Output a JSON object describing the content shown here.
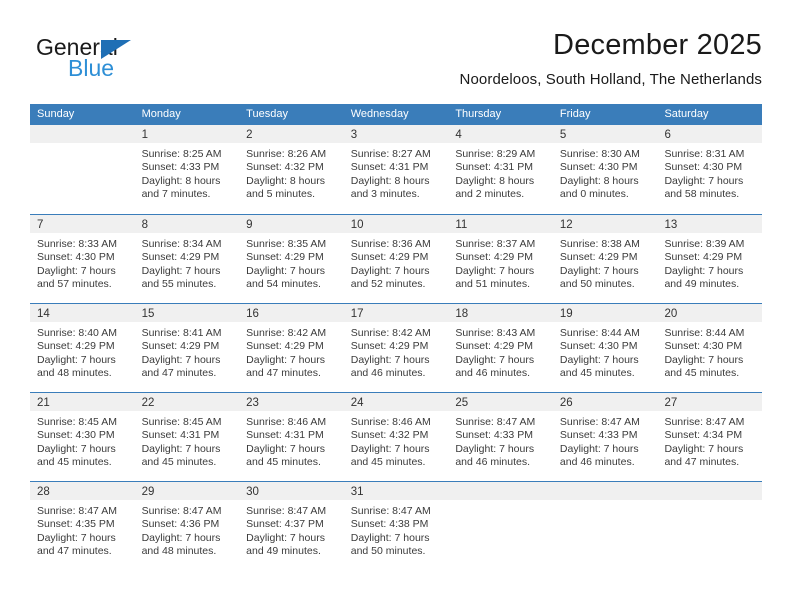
{
  "brand": {
    "name_dark": "General",
    "name_blue": "Blue",
    "accent_color": "#1f6fb5",
    "accent_light": "#2e8fd6"
  },
  "header": {
    "title": "December 2025",
    "location": "Noordeloos, South Holland, The Netherlands"
  },
  "calendar": {
    "header_color": "#3a7dba",
    "day_band_color": "#f0f0f0",
    "weekdays": [
      "Sunday",
      "Monday",
      "Tuesday",
      "Wednesday",
      "Thursday",
      "Friday",
      "Saturday"
    ],
    "weeks": [
      [
        {
          "day": "",
          "lines": []
        },
        {
          "day": "1",
          "lines": [
            "Sunrise: 8:25 AM",
            "Sunset: 4:33 PM",
            "Daylight: 8 hours",
            "and 7 minutes."
          ]
        },
        {
          "day": "2",
          "lines": [
            "Sunrise: 8:26 AM",
            "Sunset: 4:32 PM",
            "Daylight: 8 hours",
            "and 5 minutes."
          ]
        },
        {
          "day": "3",
          "lines": [
            "Sunrise: 8:27 AM",
            "Sunset: 4:31 PM",
            "Daylight: 8 hours",
            "and 3 minutes."
          ]
        },
        {
          "day": "4",
          "lines": [
            "Sunrise: 8:29 AM",
            "Sunset: 4:31 PM",
            "Daylight: 8 hours",
            "and 2 minutes."
          ]
        },
        {
          "day": "5",
          "lines": [
            "Sunrise: 8:30 AM",
            "Sunset: 4:30 PM",
            "Daylight: 8 hours",
            "and 0 minutes."
          ]
        },
        {
          "day": "6",
          "lines": [
            "Sunrise: 8:31 AM",
            "Sunset: 4:30 PM",
            "Daylight: 7 hours",
            "and 58 minutes."
          ]
        }
      ],
      [
        {
          "day": "7",
          "lines": [
            "Sunrise: 8:33 AM",
            "Sunset: 4:30 PM",
            "Daylight: 7 hours",
            "and 57 minutes."
          ]
        },
        {
          "day": "8",
          "lines": [
            "Sunrise: 8:34 AM",
            "Sunset: 4:29 PM",
            "Daylight: 7 hours",
            "and 55 minutes."
          ]
        },
        {
          "day": "9",
          "lines": [
            "Sunrise: 8:35 AM",
            "Sunset: 4:29 PM",
            "Daylight: 7 hours",
            "and 54 minutes."
          ]
        },
        {
          "day": "10",
          "lines": [
            "Sunrise: 8:36 AM",
            "Sunset: 4:29 PM",
            "Daylight: 7 hours",
            "and 52 minutes."
          ]
        },
        {
          "day": "11",
          "lines": [
            "Sunrise: 8:37 AM",
            "Sunset: 4:29 PM",
            "Daylight: 7 hours",
            "and 51 minutes."
          ]
        },
        {
          "day": "12",
          "lines": [
            "Sunrise: 8:38 AM",
            "Sunset: 4:29 PM",
            "Daylight: 7 hours",
            "and 50 minutes."
          ]
        },
        {
          "day": "13",
          "lines": [
            "Sunrise: 8:39 AM",
            "Sunset: 4:29 PM",
            "Daylight: 7 hours",
            "and 49 minutes."
          ]
        }
      ],
      [
        {
          "day": "14",
          "lines": [
            "Sunrise: 8:40 AM",
            "Sunset: 4:29 PM",
            "Daylight: 7 hours",
            "and 48 minutes."
          ]
        },
        {
          "day": "15",
          "lines": [
            "Sunrise: 8:41 AM",
            "Sunset: 4:29 PM",
            "Daylight: 7 hours",
            "and 47 minutes."
          ]
        },
        {
          "day": "16",
          "lines": [
            "Sunrise: 8:42 AM",
            "Sunset: 4:29 PM",
            "Daylight: 7 hours",
            "and 47 minutes."
          ]
        },
        {
          "day": "17",
          "lines": [
            "Sunrise: 8:42 AM",
            "Sunset: 4:29 PM",
            "Daylight: 7 hours",
            "and 46 minutes."
          ]
        },
        {
          "day": "18",
          "lines": [
            "Sunrise: 8:43 AM",
            "Sunset: 4:29 PM",
            "Daylight: 7 hours",
            "and 46 minutes."
          ]
        },
        {
          "day": "19",
          "lines": [
            "Sunrise: 8:44 AM",
            "Sunset: 4:30 PM",
            "Daylight: 7 hours",
            "and 45 minutes."
          ]
        },
        {
          "day": "20",
          "lines": [
            "Sunrise: 8:44 AM",
            "Sunset: 4:30 PM",
            "Daylight: 7 hours",
            "and 45 minutes."
          ]
        }
      ],
      [
        {
          "day": "21",
          "lines": [
            "Sunrise: 8:45 AM",
            "Sunset: 4:30 PM",
            "Daylight: 7 hours",
            "and 45 minutes."
          ]
        },
        {
          "day": "22",
          "lines": [
            "Sunrise: 8:45 AM",
            "Sunset: 4:31 PM",
            "Daylight: 7 hours",
            "and 45 minutes."
          ]
        },
        {
          "day": "23",
          "lines": [
            "Sunrise: 8:46 AM",
            "Sunset: 4:31 PM",
            "Daylight: 7 hours",
            "and 45 minutes."
          ]
        },
        {
          "day": "24",
          "lines": [
            "Sunrise: 8:46 AM",
            "Sunset: 4:32 PM",
            "Daylight: 7 hours",
            "and 45 minutes."
          ]
        },
        {
          "day": "25",
          "lines": [
            "Sunrise: 8:47 AM",
            "Sunset: 4:33 PM",
            "Daylight: 7 hours",
            "and 46 minutes."
          ]
        },
        {
          "day": "26",
          "lines": [
            "Sunrise: 8:47 AM",
            "Sunset: 4:33 PM",
            "Daylight: 7 hours",
            "and 46 minutes."
          ]
        },
        {
          "day": "27",
          "lines": [
            "Sunrise: 8:47 AM",
            "Sunset: 4:34 PM",
            "Daylight: 7 hours",
            "and 47 minutes."
          ]
        }
      ],
      [
        {
          "day": "28",
          "lines": [
            "Sunrise: 8:47 AM",
            "Sunset: 4:35 PM",
            "Daylight: 7 hours",
            "and 47 minutes."
          ]
        },
        {
          "day": "29",
          "lines": [
            "Sunrise: 8:47 AM",
            "Sunset: 4:36 PM",
            "Daylight: 7 hours",
            "and 48 minutes."
          ]
        },
        {
          "day": "30",
          "lines": [
            "Sunrise: 8:47 AM",
            "Sunset: 4:37 PM",
            "Daylight: 7 hours",
            "and 49 minutes."
          ]
        },
        {
          "day": "31",
          "lines": [
            "Sunrise: 8:47 AM",
            "Sunset: 4:38 PM",
            "Daylight: 7 hours",
            "and 50 minutes."
          ]
        },
        {
          "day": "",
          "lines": []
        },
        {
          "day": "",
          "lines": []
        },
        {
          "day": "",
          "lines": []
        }
      ]
    ]
  }
}
